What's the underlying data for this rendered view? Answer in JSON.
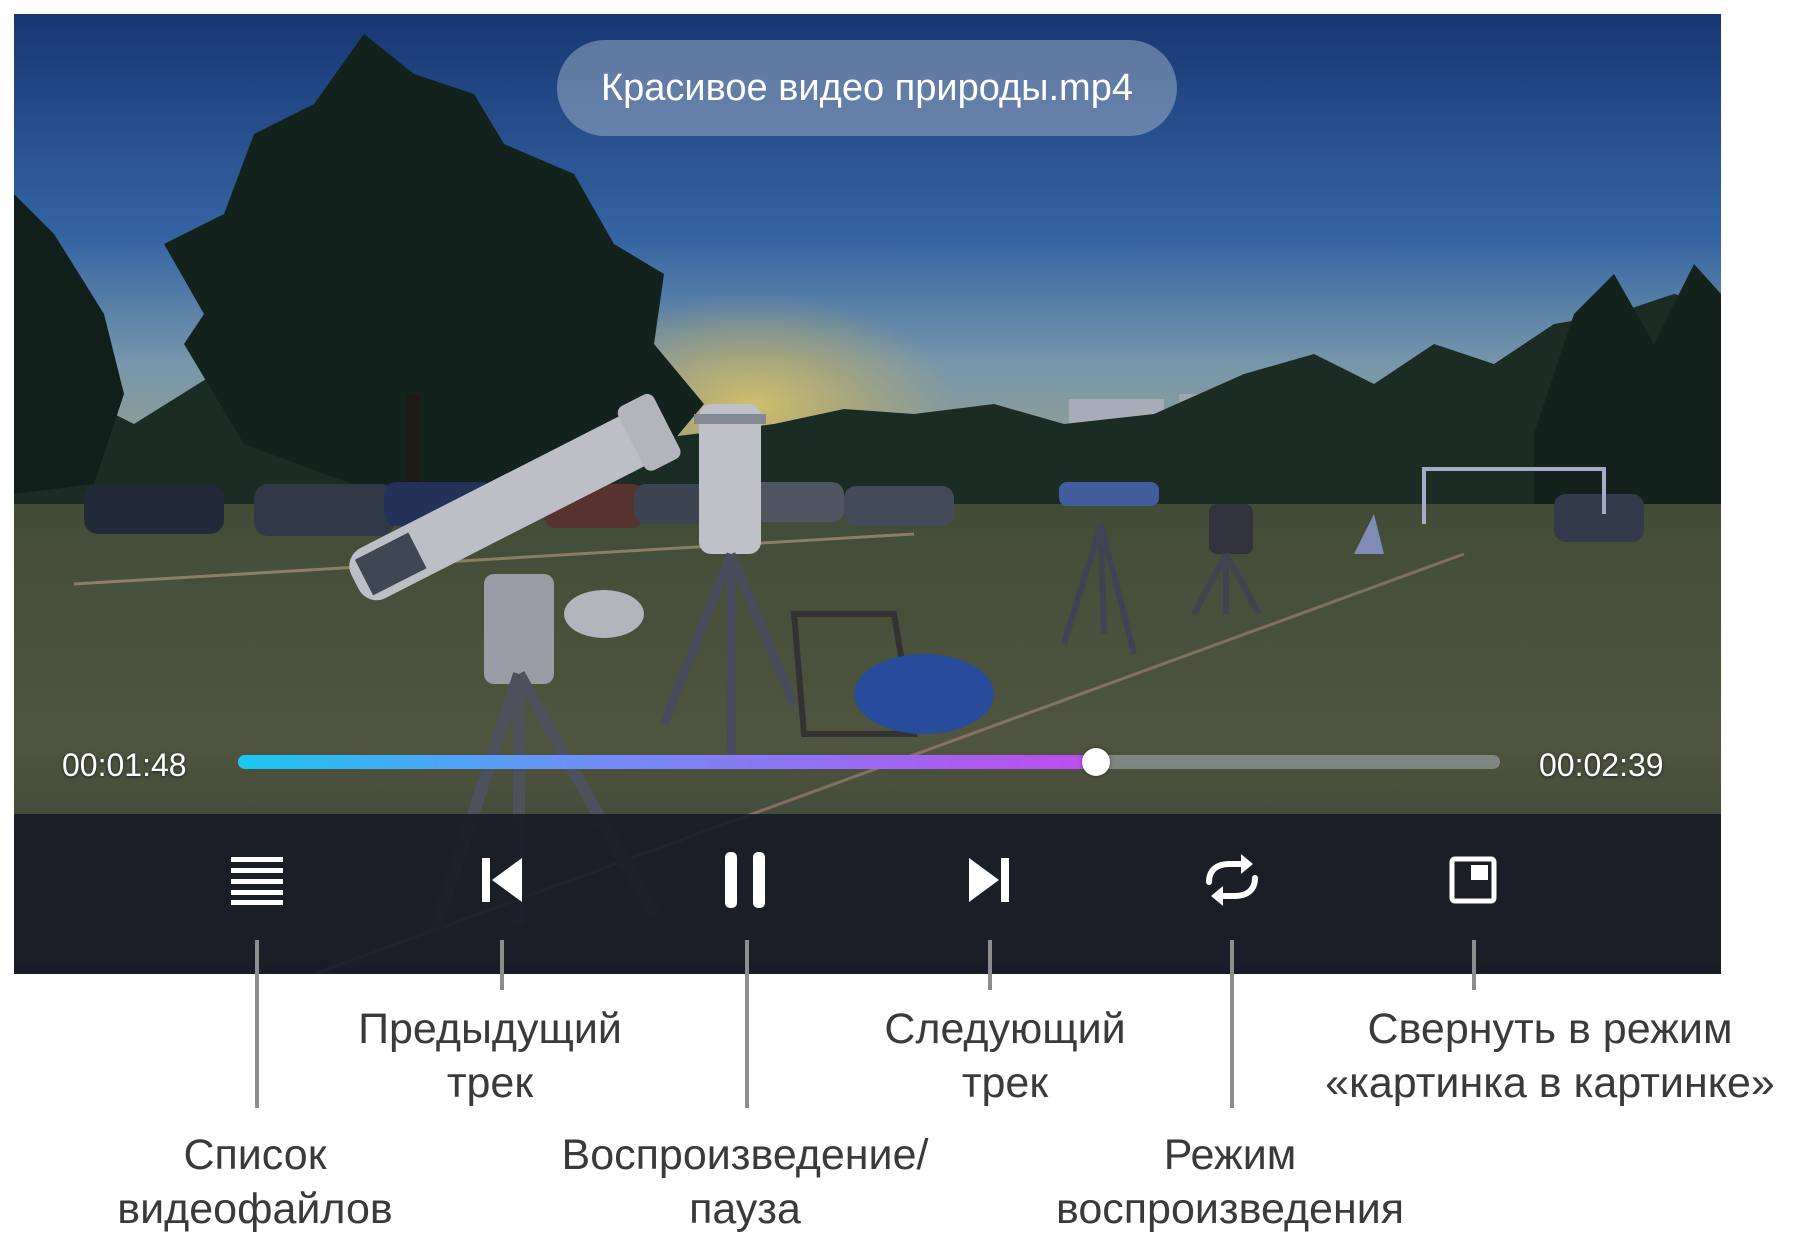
{
  "player": {
    "file_title": "Красивое видео природы.mp4",
    "current_time": "00:01:48",
    "total_time": "00:02:39",
    "progress": 0.68
  },
  "controls": {
    "playlist_icon": "list-icon",
    "prev_icon": "skip-previous-icon",
    "pause_icon": "pause-icon",
    "next_icon": "skip-next-icon",
    "repeat_icon": "repeat-icon",
    "pip_icon": "picture-in-picture-icon"
  },
  "callouts": {
    "playlist": {
      "line1": "Список",
      "line2": "видеофайлов"
    },
    "prev": {
      "line1": "Предыдущий",
      "line2": "трек"
    },
    "play_pause": {
      "line1": "Воспроизведение/",
      "line2": "пауза"
    },
    "next": {
      "line1": "Следующий",
      "line2": "трек"
    },
    "mode": {
      "line1": "Режим",
      "line2": "воспроизведения"
    },
    "pip": {
      "line1": "Свернуть в режим",
      "line2": "«картинка в картинке»"
    }
  },
  "colors": {
    "progress_start": "#1cc6f2",
    "progress_end": "#c04cf0",
    "control_bar": "#161b26",
    "callout_text": "#3a3a3a"
  }
}
